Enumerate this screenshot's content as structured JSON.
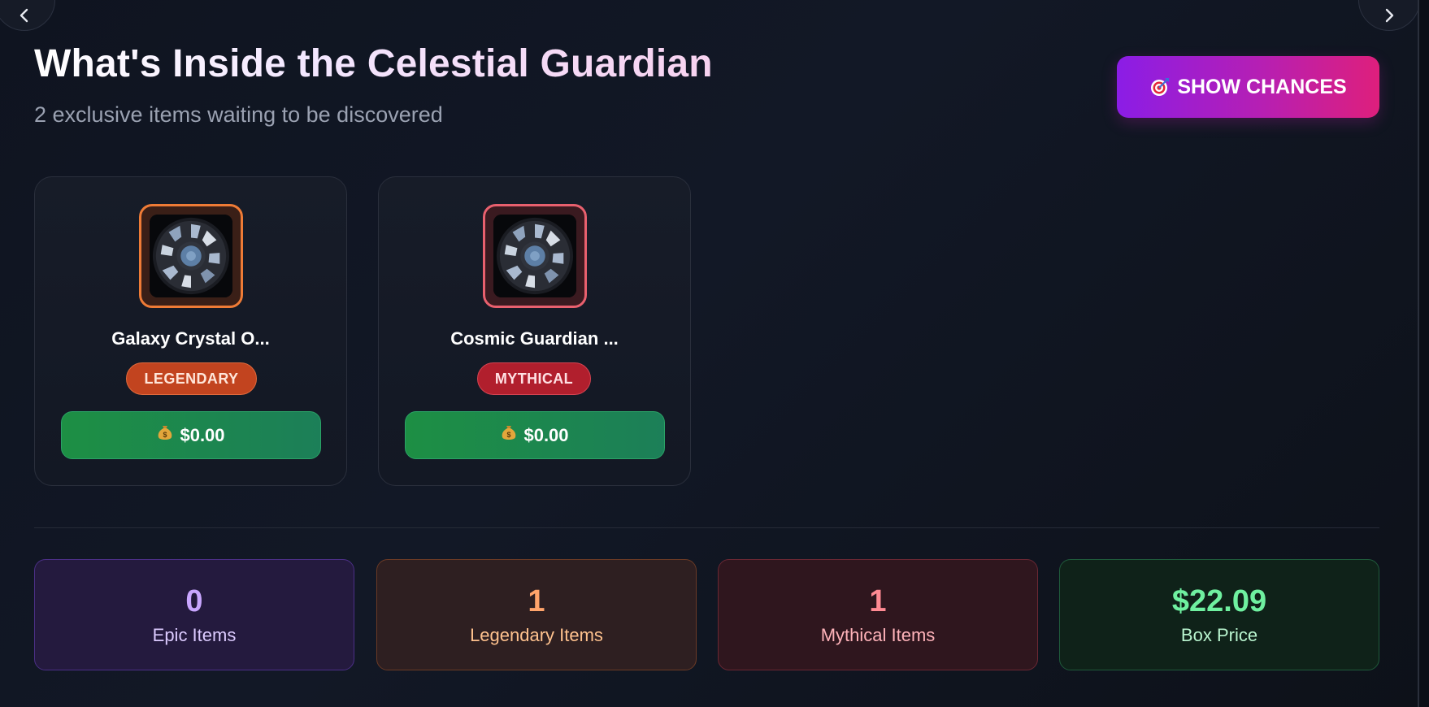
{
  "header": {
    "title": "What's Inside the Celestial Guardian",
    "subtitle": "2 exclusive items waiting to be discovered",
    "show_chances_label": "SHOW CHANCES",
    "show_chances_icon": "target-icon"
  },
  "navigation": {
    "prev_icon": "chevron-left-icon",
    "next_icon": "chevron-right-icon"
  },
  "items": [
    {
      "name": "Galaxy Crystal O...",
      "rarity": "LEGENDARY",
      "price": "$0.00",
      "price_icon": "money-bag-icon",
      "image": "space-station-window-image",
      "frame_color": "#ee7b36"
    },
    {
      "name": "Cosmic Guardian ...",
      "rarity": "MYTHICAL",
      "price": "$0.00",
      "price_icon": "money-bag-icon",
      "image": "space-station-window-image",
      "frame_color": "#e8606e"
    }
  ],
  "stats": [
    {
      "value": "0",
      "label": "Epic Items",
      "color": "#c9a6ff"
    },
    {
      "value": "1",
      "label": "Legendary Items",
      "color": "#ffa46b"
    },
    {
      "value": "1",
      "label": "Mythical Items",
      "color": "#ff8a93"
    },
    {
      "value": "$22.09",
      "label": "Box Price",
      "color": "#6ff0a0"
    }
  ],
  "colors": {
    "background": "#0f1420",
    "accent_gradient_start": "#8b1de6",
    "accent_gradient_end": "#de1f7c",
    "price_button": "#1d8f44"
  }
}
